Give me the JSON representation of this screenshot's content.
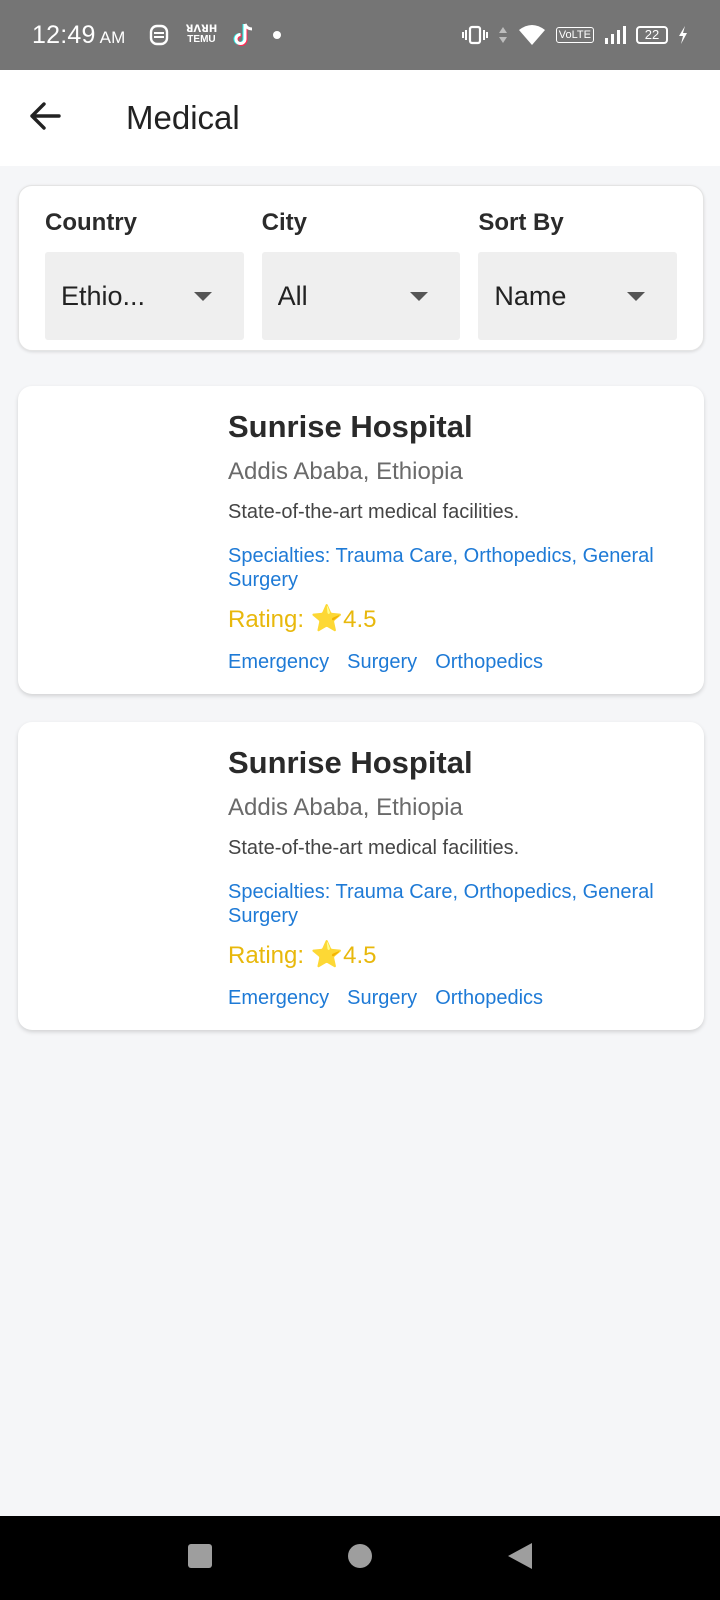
{
  "status_bar": {
    "time": "12:49",
    "ampm": "AM",
    "temu_label_top": "ꓤꓥꓤꓧ",
    "temu_label_bottom": "TEMU",
    "volte": "VoLTE",
    "battery": "22"
  },
  "app_bar": {
    "title": "Medical"
  },
  "filters": {
    "country": {
      "label": "Country",
      "value": "Ethio..."
    },
    "city": {
      "label": "City",
      "value": "All"
    },
    "sort": {
      "label": "Sort By",
      "value": "Name"
    }
  },
  "hospitals": [
    {
      "name": "Sunrise Hospital",
      "location": "Addis Ababa, Ethiopia",
      "description": "State-of-the-art medical facilities.",
      "specialties": "Specialties: Trauma Care, Orthopedics, General Surgery",
      "rating_label": "Rating: ",
      "rating_star": "⭐",
      "rating_value": "4.5",
      "tags": [
        "Emergency",
        "Surgery",
        "Orthopedics"
      ]
    },
    {
      "name": "Sunrise Hospital",
      "location": "Addis Ababa, Ethiopia",
      "description": "State-of-the-art medical facilities.",
      "specialties": "Specialties: Trauma Care, Orthopedics, General Surgery",
      "rating_label": "Rating: ",
      "rating_star": "⭐",
      "rating_value": "4.5",
      "tags": [
        "Emergency",
        "Surgery",
        "Orthopedics"
      ]
    }
  ],
  "nav_bar": {
    "icons": [
      "recents-square-icon",
      "home-circle-icon",
      "back-triangle-icon"
    ]
  },
  "colors": {
    "status_bar": "#757575",
    "link_blue": "#1e7ad6",
    "rating_gold": "#e8b80c",
    "background": "#f5f6f8"
  }
}
